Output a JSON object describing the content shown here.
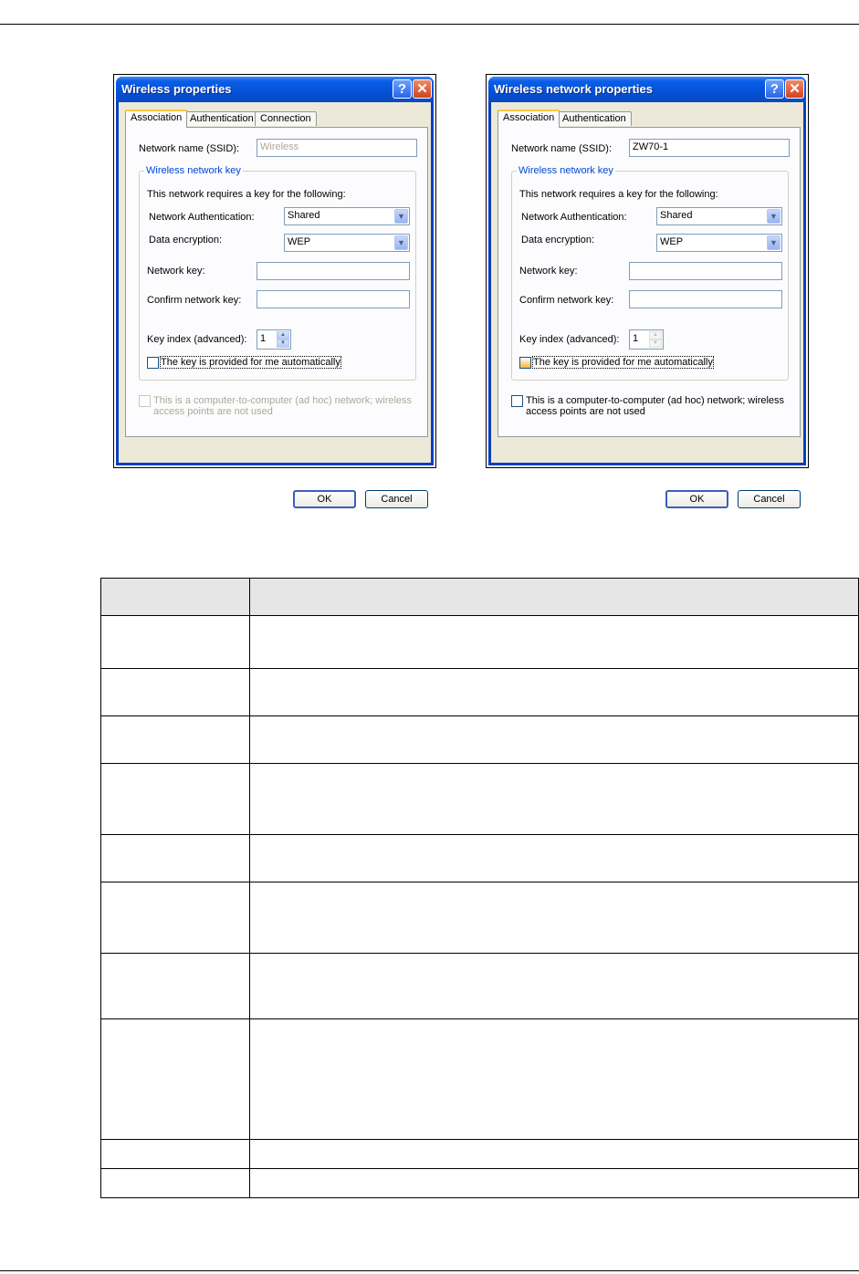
{
  "dialogs": [
    {
      "title": "Wireless properties",
      "tabs": [
        "Association",
        "Authentication",
        "Connection"
      ],
      "ssid_label": "Network name (SSID):",
      "ssid_value": "Wireless",
      "group_label": "Wireless network key",
      "key_intro": "This network requires a key for the following:",
      "auth_label": "Network Authentication:",
      "auth_value": "Shared",
      "enc_label": "Data encryption:",
      "enc_value": "WEP",
      "netkey_label": "Network key:",
      "confirm_label": "Confirm network key:",
      "keyindex_label": "Key index (advanced):",
      "keyindex_value": "1",
      "auto_key_label": "The key is provided for me automatically",
      "adhoc_line1": "This is a computer-to-computer (ad hoc) network; wireless",
      "adhoc_line2": "access points are not used",
      "ok": "OK",
      "cancel": "Cancel"
    },
    {
      "title": "Wireless network properties",
      "tabs": [
        "Association",
        "Authentication"
      ],
      "ssid_label": "Network name (SSID):",
      "ssid_value": "ZW70-1",
      "group_label": "Wireless network key",
      "key_intro": "This network requires a key for the following:",
      "auth_label": "Network Authentication:",
      "auth_value": "Shared",
      "enc_label": "Data encryption:",
      "enc_value": "WEP",
      "netkey_label": "Network key:",
      "confirm_label": "Confirm network key:",
      "keyindex_label": "Key index (advanced):",
      "keyindex_value": "1",
      "auto_key_label": "The key is provided for me automatically",
      "adhoc_line1": "This is a computer-to-computer (ad hoc) network; wireless",
      "adhoc_line2": "access points are not used",
      "ok": "OK",
      "cancel": "Cancel"
    }
  ],
  "titlebar_buttons": {
    "help": "?",
    "close": "✕"
  },
  "colors": {
    "titlebar": "#0451d6",
    "client": "#ece9d8",
    "tab_highlight": "#ffc73c",
    "table_header": "#e6e6e6"
  }
}
